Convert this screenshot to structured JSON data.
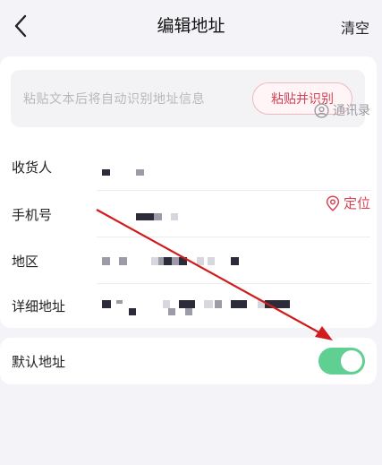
{
  "navbar": {
    "title": "编辑地址",
    "clear_label": "清空",
    "back_icon": "chevron-left-icon"
  },
  "paste": {
    "placeholder": "粘贴文本后将自动识别地址信息",
    "button_label": "粘贴并识别"
  },
  "form": {
    "receiver_label": "收货人",
    "contacts_label": "通讯录",
    "phone_label": "手机号",
    "region_label": "地区",
    "locate_label": "定位",
    "detail_label": "详细地址"
  },
  "default_address": {
    "label": "默认地址",
    "enabled": true
  },
  "colors": {
    "accent_red": "#d64356",
    "toggle_green": "#5fcf92",
    "annotation_arrow": "#d01c1c"
  }
}
